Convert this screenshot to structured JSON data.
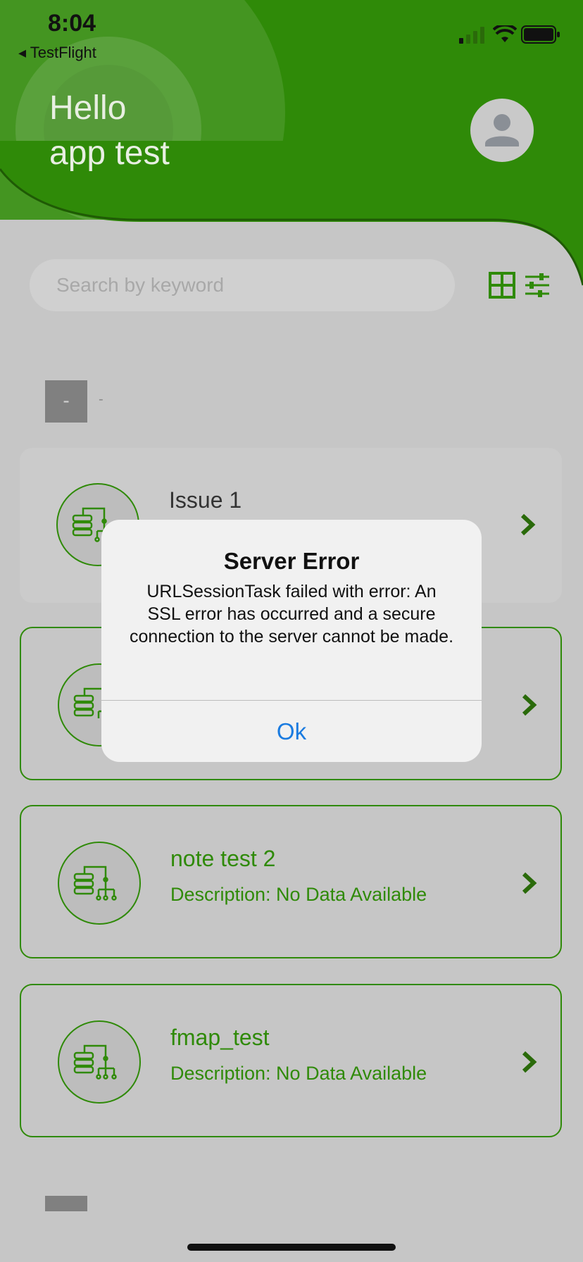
{
  "status_bar": {
    "time": "8:04",
    "back_label": "◂ TestFlight"
  },
  "header": {
    "greeting": "Hello",
    "user_name": "app test"
  },
  "search": {
    "placeholder": "Search by keyword"
  },
  "section": {
    "badge": "-",
    "label": "-"
  },
  "cards": [
    {
      "title": "Issue 1",
      "description": ""
    },
    {
      "title": "",
      "description": ""
    },
    {
      "title": "note test 2",
      "description": "Description: No Data Available"
    },
    {
      "title": "fmap_test",
      "description": "Description: No Data Available"
    }
  ],
  "alert": {
    "title": "Server Error",
    "message": "URLSessionTask failed with error: An SSL error has occurred and a secure connection to the server cannot be made.",
    "ok_label": "Ok"
  },
  "colors": {
    "brand_green": "#2f8a08",
    "link_blue": "#1a7be0"
  }
}
